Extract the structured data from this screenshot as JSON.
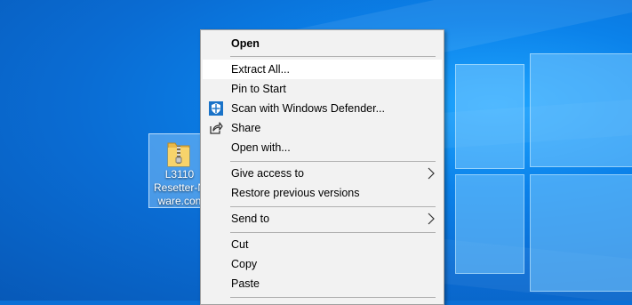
{
  "desktop_file": {
    "label": "L3110\nResetter-N\nware.con",
    "icon": "zip-folder-icon"
  },
  "context_menu": {
    "open": "Open",
    "extract_all": "Extract All...",
    "pin_to_start": "Pin to Start",
    "scan_defender": "Scan with Windows Defender...",
    "share": "Share",
    "open_with": "Open with...",
    "give_access_to": "Give access to",
    "restore_previous_versions": "Restore previous versions",
    "send_to": "Send to",
    "cut": "Cut",
    "copy": "Copy",
    "paste": "Paste"
  },
  "colors": {
    "menu_background": "#f2f2f2",
    "menu_highlight": "#ffffff",
    "desktop_blue": "#0a6fd6"
  }
}
